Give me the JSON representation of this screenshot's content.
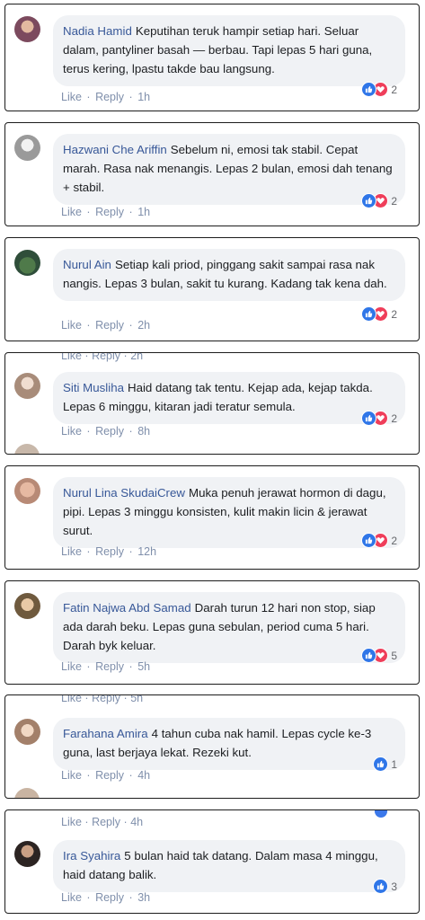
{
  "actions": {
    "like": "Like",
    "reply": "Reply",
    "separator": "·"
  },
  "colors": {
    "author": "#385898",
    "like_reaction": "#2f76e8",
    "love_reaction": "#ef3e5a"
  },
  "comments": [
    {
      "author": "Nadia Hamid",
      "text": "Keputihan teruk hampir setiap hari. Seluar dalam, pantyliner basah — berbau. Tapi lepas 5 hari guna, terus kering, lpastu takde bau langsung.",
      "time": "1h",
      "reactions": [
        "like",
        "love"
      ],
      "count": "2",
      "ghost_time": ""
    },
    {
      "author": "Hazwani Che Ariffin",
      "text": "Sebelum ni, emosi tak stabil. Cepat marah. Rasa nak menangis. Lepas 2 bulan, emosi dah tenang + stabil.",
      "time": "1h",
      "reactions": [
        "like",
        "love"
      ],
      "count": "2",
      "ghost_time": ""
    },
    {
      "author": "Nurul Ain",
      "text": "Setiap kali priod, pinggang sakit sampai rasa nak nangis. Lepas 3 bulan, sakit tu kurang. Kadang tak kena dah.",
      "time": "2h",
      "reactions": [
        "like",
        "love"
      ],
      "count": "2",
      "ghost_time": ""
    },
    {
      "author": "Siti Musliha",
      "text": "Haid datang tak tentu. Kejap ada, kejap takda. Lepas 6 minggu, kitaran jadi teratur semula.",
      "time": "8h",
      "reactions": [
        "like",
        "love"
      ],
      "count": "2",
      "ghost_time": "2h"
    },
    {
      "author": "Nurul Lina SkudaiCrew",
      "text": "Muka penuh jerawat hormon di dagu, pipi. Lepas 3 minggu konsisten, kulit makin licin & jerawat surut.",
      "time": "12h",
      "reactions": [
        "like",
        "love"
      ],
      "count": "2",
      "ghost_time": ""
    },
    {
      "author": "Fatin Najwa Abd Samad",
      "text": "Darah turun 12 hari non stop, siap ada darah beku. Lepas guna sebulan, period cuma 5 hari. Darah byk keluar.",
      "time": "5h",
      "reactions": [
        "like",
        "love"
      ],
      "count": "5",
      "ghost_time": ""
    },
    {
      "author": "Farahana Amira",
      "text": "4 tahun cuba nak hamil. Lepas cycle ke-3 guna, last berjaya lekat. Rezeki kut.",
      "time": "4h",
      "reactions": [
        "like"
      ],
      "count": "1",
      "ghost_time": "5h"
    },
    {
      "author": "Ira Syahira",
      "text": "5 bulan haid tak datang. Dalam masa 4 minggu, haid datang balik.",
      "time": "3h",
      "reactions": [
        "like"
      ],
      "count": "3",
      "ghost_time": "4h"
    }
  ]
}
